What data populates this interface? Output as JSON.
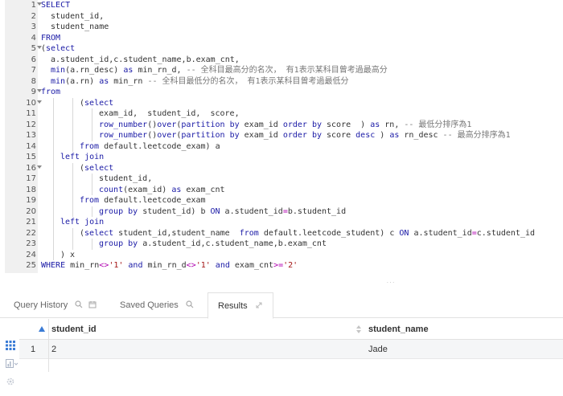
{
  "editor": {
    "lines": [
      {
        "n": "1",
        "fold": true,
        "indent": 0,
        "tokens": [
          [
            "kw",
            "SELECT"
          ]
        ]
      },
      {
        "n": "2",
        "fold": false,
        "indent": 1,
        "tokens": [
          [
            "tx",
            "student_id,"
          ]
        ]
      },
      {
        "n": "3",
        "fold": false,
        "indent": 1,
        "tokens": [
          [
            "tx",
            "student_name"
          ]
        ]
      },
      {
        "n": "4",
        "fold": false,
        "indent": 0,
        "tokens": [
          [
            "kw",
            "FROM"
          ]
        ]
      },
      {
        "n": "5",
        "fold": true,
        "indent": 0,
        "tokens": [
          [
            "tx",
            "("
          ],
          [
            "kw",
            "select"
          ]
        ]
      },
      {
        "n": "6",
        "fold": false,
        "indent": 1,
        "tokens": [
          [
            "tx",
            "a.student_id,c.student_name,b.exam_cnt,"
          ]
        ]
      },
      {
        "n": "7",
        "fold": false,
        "indent": 1,
        "tokens": [
          [
            "fn",
            "min"
          ],
          [
            "tx",
            "(a.rn_desc) "
          ],
          [
            "kw",
            "as"
          ],
          [
            "tx",
            " min_rn_d, "
          ],
          [
            "cm",
            "-- 全科目最高分的名次， 有1表示某科目曾考過最高分"
          ]
        ]
      },
      {
        "n": "8",
        "fold": false,
        "indent": 1,
        "tokens": [
          [
            "fn",
            "min"
          ],
          [
            "tx",
            "(a.rn) "
          ],
          [
            "kw",
            "as"
          ],
          [
            "tx",
            " min_rn "
          ],
          [
            "cm",
            "-- 全科目最低分的名次， 有1表示某科目曾考過最低分"
          ]
        ]
      },
      {
        "n": "9",
        "fold": true,
        "indent": 0,
        "tokens": [
          [
            "kw",
            "from"
          ]
        ]
      },
      {
        "n": "10",
        "fold": true,
        "indent": 4,
        "tokens": [
          [
            "tx",
            "("
          ],
          [
            "kw",
            "select"
          ]
        ]
      },
      {
        "n": "11",
        "fold": false,
        "indent": 6,
        "tokens": [
          [
            "tx",
            "exam_id,  student_id,  score,"
          ]
        ]
      },
      {
        "n": "12",
        "fold": false,
        "indent": 6,
        "tokens": [
          [
            "fn",
            "row_number"
          ],
          [
            "tx",
            "()"
          ],
          [
            "fn",
            "over"
          ],
          [
            "tx",
            "("
          ],
          [
            "kw",
            "partition by"
          ],
          [
            "tx",
            " exam_id "
          ],
          [
            "kw",
            "order by"
          ],
          [
            "tx",
            " score  ) "
          ],
          [
            "kw",
            "as"
          ],
          [
            "tx",
            " rn, "
          ],
          [
            "cm",
            "-- 最低分排序為1"
          ]
        ]
      },
      {
        "n": "13",
        "fold": false,
        "indent": 6,
        "tokens": [
          [
            "fn",
            "row_number"
          ],
          [
            "tx",
            "()"
          ],
          [
            "fn",
            "over"
          ],
          [
            "tx",
            "("
          ],
          [
            "kw",
            "partition by"
          ],
          [
            "tx",
            " exam_id "
          ],
          [
            "kw",
            "order by"
          ],
          [
            "tx",
            " score "
          ],
          [
            "kw",
            "desc"
          ],
          [
            "tx",
            " ) "
          ],
          [
            "kw",
            "as"
          ],
          [
            "tx",
            " rn_desc "
          ],
          [
            "cm",
            "-- 最高分排序為1"
          ]
        ]
      },
      {
        "n": "14",
        "fold": false,
        "indent": 4,
        "tokens": [
          [
            "kw",
            "from"
          ],
          [
            "tx",
            " default.leetcode_exam) a"
          ]
        ]
      },
      {
        "n": "15",
        "fold": false,
        "indent": 2,
        "tokens": [
          [
            "kw",
            "left join"
          ]
        ]
      },
      {
        "n": "16",
        "fold": true,
        "indent": 4,
        "tokens": [
          [
            "tx",
            "("
          ],
          [
            "kw",
            "select"
          ]
        ]
      },
      {
        "n": "17",
        "fold": false,
        "indent": 6,
        "tokens": [
          [
            "tx",
            "student_id,"
          ]
        ]
      },
      {
        "n": "18",
        "fold": false,
        "indent": 6,
        "tokens": [
          [
            "fn",
            "count"
          ],
          [
            "tx",
            "(exam_id) "
          ],
          [
            "kw",
            "as"
          ],
          [
            "tx",
            " exam_cnt"
          ]
        ]
      },
      {
        "n": "19",
        "fold": false,
        "indent": 4,
        "tokens": [
          [
            "kw",
            "from"
          ],
          [
            "tx",
            " default.leetcode_exam"
          ]
        ]
      },
      {
        "n": "20",
        "fold": false,
        "indent": 6,
        "tokens": [
          [
            "kw",
            "group by"
          ],
          [
            "tx",
            " student_id) b "
          ],
          [
            "kw",
            "ON"
          ],
          [
            "tx",
            " a.student_id"
          ],
          [
            "op",
            "="
          ],
          [
            "tx",
            "b.student_id"
          ]
        ]
      },
      {
        "n": "21",
        "fold": false,
        "indent": 2,
        "tokens": [
          [
            "kw",
            "left join"
          ]
        ]
      },
      {
        "n": "22",
        "fold": false,
        "indent": 4,
        "tokens": [
          [
            "tx",
            "("
          ],
          [
            "kw",
            "select"
          ],
          [
            "tx",
            " student_id,student_name  "
          ],
          [
            "kw",
            "from"
          ],
          [
            "tx",
            " default.leetcode_student) c "
          ],
          [
            "kw",
            "ON"
          ],
          [
            "tx",
            " a.student_id"
          ],
          [
            "op",
            "="
          ],
          [
            "tx",
            "c.student_id"
          ]
        ]
      },
      {
        "n": "23",
        "fold": false,
        "indent": 6,
        "tokens": [
          [
            "kw",
            "group by"
          ],
          [
            "tx",
            " a.student_id,c.student_name,b.exam_cnt"
          ]
        ]
      },
      {
        "n": "24",
        "fold": false,
        "indent": 2,
        "tokens": [
          [
            "tx",
            ") x"
          ]
        ]
      },
      {
        "n": "25",
        "fold": false,
        "indent": 0,
        "tokens": [
          [
            "kw",
            "WHERE"
          ],
          [
            "tx",
            " min_rn"
          ],
          [
            "op",
            "<>"
          ],
          [
            "str",
            "'1'"
          ],
          [
            "tx",
            " "
          ],
          [
            "kw",
            "and"
          ],
          [
            "tx",
            " min_rn_d"
          ],
          [
            "op",
            "<>"
          ],
          [
            "str",
            "'1'"
          ],
          [
            "tx",
            " "
          ],
          [
            "kw",
            "and"
          ],
          [
            "tx",
            " exam_cnt"
          ],
          [
            "op",
            ">="
          ],
          [
            "str",
            "'2'"
          ]
        ]
      }
    ]
  },
  "splitter": {
    "handle": "···"
  },
  "tabs": {
    "query_history": "Query History",
    "saved_queries": "Saved Queries",
    "results": "Results"
  },
  "results": {
    "columns": [
      "student_id",
      "student_name"
    ],
    "rows": [
      {
        "num": "1",
        "student_id": "2",
        "student_name": "Jade"
      }
    ]
  },
  "colors": {
    "keyword": "#1a1aa6",
    "comment": "#777777",
    "string": "#a31515",
    "operator": "#b000b0",
    "gutter": "#f0f0f0"
  }
}
